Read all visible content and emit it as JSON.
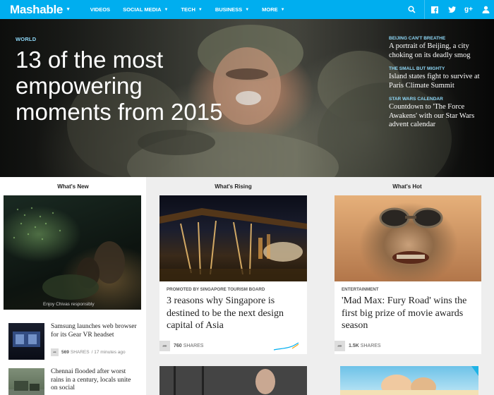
{
  "nav": {
    "logo": "Mashable",
    "items": [
      "VIDEOS",
      "SOCIAL MEDIA",
      "TECH",
      "BUSINESS",
      "MORE"
    ],
    "icons": [
      "search-icon",
      "facebook-icon",
      "twitter-icon",
      "google-plus-icon",
      "user-icon"
    ],
    "accent_color": "#00aeef"
  },
  "hero": {
    "kicker": "WORLD",
    "title": "13 of the most empowering moments from 2015",
    "side": [
      {
        "kicker": "BEIJING CAN'T BREATHE",
        "title": "A portrait of Beijing, a city choking on its deadly smog"
      },
      {
        "kicker": "THE SMALL BUT MIGHTY",
        "title": "Island states fight to survive at Paris Climate Summit"
      },
      {
        "kicker": "STAR WARS CALENDAR",
        "title": "Countdown to 'The Force Awakens' with our Star Wars advent calendar"
      }
    ]
  },
  "columns": {
    "new": {
      "header": "What's New",
      "feature_caption": "Enjoy Chivas responsibly",
      "items": [
        {
          "title": "Samsung launches web browser for its Gear VR headset",
          "shares": "569",
          "shares_label": "SHARES",
          "time": "/ 17 minutes ago"
        },
        {
          "title": "Chennai flooded after worst rains in a century, locals unite on social"
        }
      ]
    },
    "rising": {
      "header": "What's Rising",
      "promo": "PROMOTED BY SINGAPORE TOURISM BOARD",
      "title": "3 reasons why Singapore is destined to be the next design capital of Asia",
      "shares": "760",
      "shares_label": "SHARES"
    },
    "hot": {
      "header": "What's Hot",
      "promo": "ENTERTAINMENT",
      "title": "'Mad Max: Fury Road' wins the first big prize of movie awards season",
      "shares": "1.5K",
      "shares_label": "SHARES"
    }
  }
}
